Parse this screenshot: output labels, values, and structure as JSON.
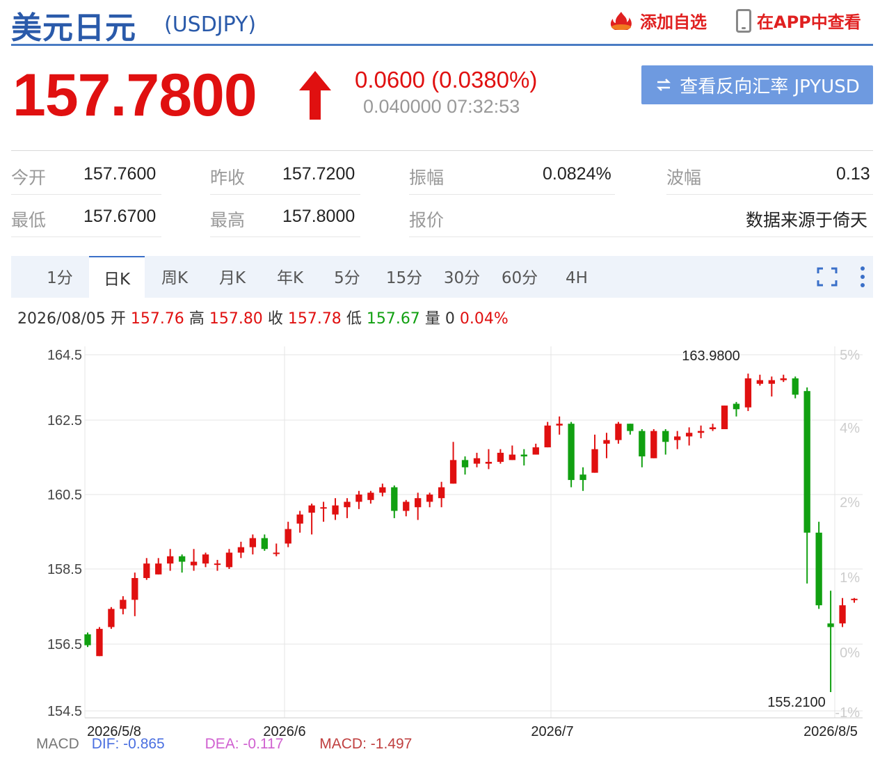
{
  "header": {
    "title": "美元日元",
    "code": "(USDJPY)",
    "add_watch": "添加自选",
    "view_app": "在APP中查看"
  },
  "quote": {
    "price": "157.7800",
    "change": "0.0600 (0.0380%)",
    "sub": "0.040000 07:32:53",
    "reverse_button": "查看反向汇率 JPYUSD",
    "up_color": "#e01010"
  },
  "stats": {
    "open_label": "今开",
    "open": "157.7600",
    "prev_close_label": "昨收",
    "prev_close": "157.7200",
    "amplitude_label": "振幅",
    "amplitude": "0.0824%",
    "wave_label": "波幅",
    "wave": "0.13",
    "low_label": "最低",
    "low": "157.6700",
    "high_label": "最高",
    "high": "157.8000",
    "quote_label": "报价",
    "source": "数据来源于倚天"
  },
  "tabs": [
    "1分",
    "日K",
    "周K",
    "月K",
    "年K",
    "5分",
    "15分",
    "30分",
    "60分",
    "4H"
  ],
  "active_tab": "日K",
  "ohlc": {
    "date": "2026/08/05",
    "open_label": "开",
    "open": "157.76",
    "high_label": "高",
    "high": "157.80",
    "close_label": "收",
    "close": "157.78",
    "low_label": "低",
    "low": "157.67",
    "vol_label": "量",
    "vol": "0",
    "pct": "0.04%"
  },
  "macd": {
    "label": "MACD",
    "dif": "DIF: -0.865",
    "dea": "DEA: -0.117",
    "macd": "MACD: -1.497"
  },
  "colors": {
    "up": "#e01010",
    "down": "#11a011",
    "grid": "#e4e4e4",
    "accent": "#3a6fc8"
  },
  "chart_data": {
    "type": "candlestick",
    "y_ticks": [
      "164.5",
      "162.5",
      "160.5",
      "158.5",
      "156.5",
      "154.5"
    ],
    "ylim": [
      154.5,
      164.5
    ],
    "right_ticks": [
      "5%",
      "4%",
      "2%",
      "1%",
      "0%",
      "-1%"
    ],
    "x_labels": [
      "2026/5/8",
      "2026/6",
      "2026/7",
      "2026/8/5"
    ],
    "max_label": "163.9800",
    "min_label": "155.2100",
    "candles": [
      [
        156.8,
        156.5,
        156.85,
        156.45
      ],
      [
        156.2,
        156.95,
        157.0,
        156.2
      ],
      [
        157.0,
        157.5,
        157.55,
        156.95
      ],
      [
        157.5,
        157.75,
        157.85,
        157.35
      ],
      [
        157.75,
        158.35,
        158.5,
        157.3
      ],
      [
        158.35,
        158.75,
        158.9,
        158.3
      ],
      [
        158.45,
        158.75,
        158.9,
        158.45
      ],
      [
        158.75,
        158.95,
        159.15,
        158.55
      ],
      [
        158.95,
        158.8,
        159.0,
        158.5
      ],
      [
        158.7,
        158.8,
        159.15,
        158.55
      ],
      [
        158.75,
        159.0,
        159.05,
        158.65
      ],
      [
        158.75,
        158.75,
        158.85,
        158.55
      ],
      [
        158.65,
        159.05,
        159.15,
        158.6
      ],
      [
        159.05,
        159.2,
        159.35,
        158.9
      ],
      [
        159.2,
        159.45,
        159.55,
        159.0
      ],
      [
        159.45,
        159.15,
        159.55,
        159.1
      ],
      [
        159.05,
        159.05,
        159.3,
        158.95
      ],
      [
        159.3,
        159.7,
        159.9,
        159.2
      ],
      [
        159.85,
        160.1,
        160.2,
        159.6
      ],
      [
        160.15,
        160.35,
        160.4,
        159.55
      ],
      [
        160.3,
        160.3,
        160.45,
        159.9
      ],
      [
        160.1,
        160.35,
        160.55,
        159.95
      ],
      [
        160.3,
        160.45,
        160.55,
        160.0
      ],
      [
        160.45,
        160.65,
        160.75,
        160.25
      ],
      [
        160.5,
        160.7,
        160.75,
        160.4
      ],
      [
        160.7,
        160.85,
        160.95,
        160.6
      ],
      [
        160.85,
        160.2,
        160.9,
        160.0
      ],
      [
        160.2,
        160.45,
        160.5,
        160.05
      ],
      [
        160.3,
        160.55,
        160.7,
        159.95
      ],
      [
        160.45,
        160.65,
        160.7,
        160.3
      ],
      [
        160.55,
        160.85,
        161.0,
        160.3
      ],
      [
        160.95,
        161.6,
        162.1,
        160.95
      ],
      [
        161.6,
        161.4,
        161.7,
        161.2
      ],
      [
        161.5,
        161.65,
        161.8,
        161.4
      ],
      [
        161.5,
        161.55,
        161.9,
        161.35
      ],
      [
        161.55,
        161.8,
        161.9,
        161.5
      ],
      [
        161.6,
        161.75,
        162.0,
        161.6
      ],
      [
        161.75,
        161.7,
        161.9,
        161.45
      ],
      [
        161.75,
        161.95,
        162.05,
        161.75
      ],
      [
        161.95,
        162.55,
        162.65,
        161.95
      ],
      [
        162.55,
        162.6,
        162.8,
        162.3
      ],
      [
        162.6,
        161.05,
        162.65,
        160.85
      ],
      [
        161.2,
        161.05,
        161.4,
        160.75
      ],
      [
        161.25,
        161.9,
        162.3,
        161.25
      ],
      [
        162.05,
        162.15,
        162.35,
        161.65
      ],
      [
        162.15,
        162.6,
        162.65,
        162.05
      ],
      [
        162.6,
        162.4,
        162.6,
        162.3
      ],
      [
        162.4,
        161.7,
        162.45,
        161.4
      ],
      [
        161.65,
        162.4,
        162.45,
        161.65
      ],
      [
        162.4,
        162.1,
        162.45,
        161.75
      ],
      [
        162.15,
        162.25,
        162.4,
        161.9
      ],
      [
        162.25,
        162.35,
        162.5,
        162.0
      ],
      [
        162.35,
        162.4,
        162.55,
        162.2
      ],
      [
        162.45,
        162.5,
        162.6,
        162.4
      ],
      [
        162.45,
        163.1,
        163.1,
        162.45
      ],
      [
        163.15,
        163.0,
        163.2,
        162.8
      ],
      [
        163.05,
        163.85,
        163.98,
        162.95
      ],
      [
        163.7,
        163.8,
        163.95,
        163.65
      ],
      [
        163.7,
        163.8,
        163.9,
        163.35
      ],
      [
        163.8,
        163.85,
        163.95,
        163.75
      ],
      [
        163.85,
        163.4,
        163.9,
        163.3
      ],
      [
        163.5,
        159.6,
        163.6,
        158.2
      ],
      [
        159.6,
        157.6,
        159.9,
        157.5
      ],
      [
        157.1,
        157.0,
        158.0,
        155.21
      ],
      [
        157.1,
        157.6,
        157.8,
        157.0
      ],
      [
        157.76,
        157.78,
        157.8,
        157.67
      ]
    ]
  }
}
